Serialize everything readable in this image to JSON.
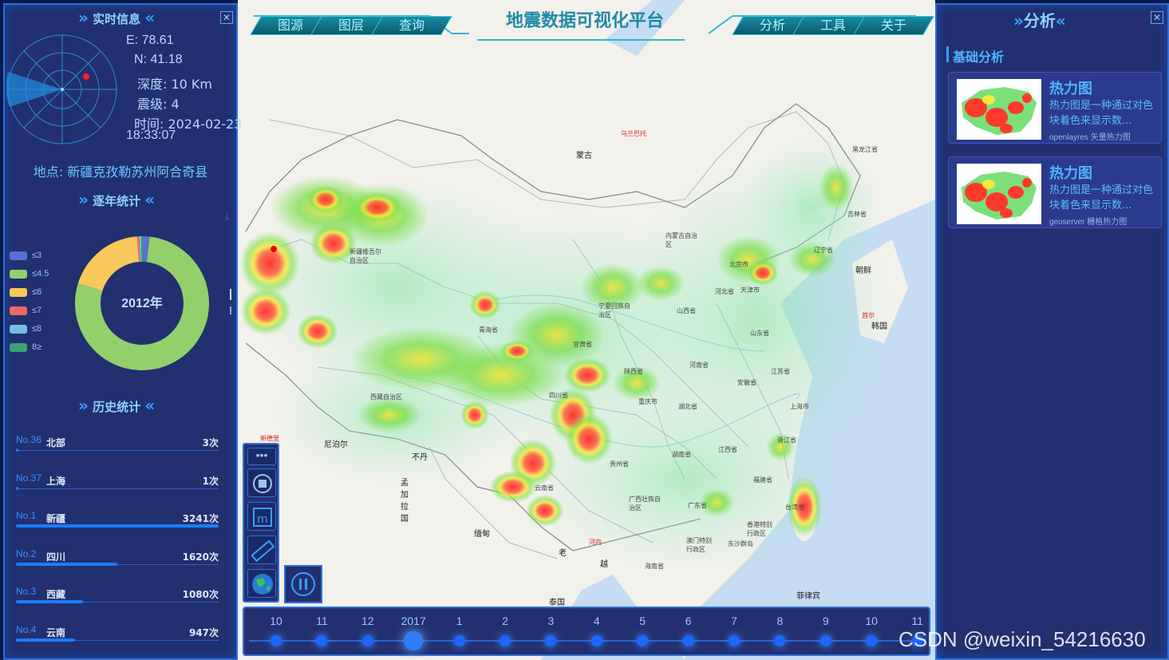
{
  "top": {
    "title": "地震数据可视化平台",
    "left_tabs": [
      "图源",
      "图层",
      "查询"
    ],
    "right_tabs": [
      "分析",
      "工具",
      "关于"
    ]
  },
  "realtime": {
    "title": "实时信息",
    "e": "E: 78.61",
    "n": "N: 41.18",
    "depth": "深度: 10 Km",
    "magnitude": "震级: 4",
    "time_line1": "时间: 2024-02-23",
    "time_line2": "18:33:07",
    "location": "地点: 新疆克孜勒苏州阿合奇县"
  },
  "yearly": {
    "title": "逐年统计",
    "center_label": "2012年",
    "legend": [
      {
        "label": "≤3",
        "color": "#5a6fd6"
      },
      {
        "label": "≤4.5",
        "color": "#93cf6b"
      },
      {
        "label": "≤6",
        "color": "#f8c85a"
      },
      {
        "label": "≤7",
        "color": "#ef6666"
      },
      {
        "label": "≤8",
        "color": "#73c0de"
      },
      {
        "label": "8≥",
        "color": "#3ba272"
      }
    ],
    "donut_values": [
      1.5,
      78,
      19,
      0.5,
      0.5,
      0.5
    ]
  },
  "history": {
    "title": "历史统计",
    "rows": [
      {
        "no": "No.36",
        "name": "北部",
        "count": "3次",
        "fraction": 0.0
      },
      {
        "no": "No.37",
        "name": "上海",
        "count": "1次",
        "fraction": 0.0
      },
      {
        "no": "No.1",
        "name": "新疆",
        "count": "3241次",
        "fraction": 1.0
      },
      {
        "no": "No.2",
        "name": "四川",
        "count": "1620次",
        "fraction": 0.5
      },
      {
        "no": "No.3",
        "name": "西藏",
        "count": "1080次",
        "fraction": 0.33
      },
      {
        "no": "No.4",
        "name": "云南",
        "count": "947次",
        "fraction": 0.29
      }
    ]
  },
  "analysis": {
    "title": "分析",
    "section": "基础分析",
    "cards": [
      {
        "title": "热力图",
        "desc": "热力图是一种通过对色块着色来显示数...",
        "source": "openlayres 矢量热力图"
      },
      {
        "title": "热力图",
        "desc": "热力图是一种通过对色块着色来显示数...",
        "source": "geoserver 栅格热力图"
      }
    ]
  },
  "map_labels": {
    "mongolia": "蒙古",
    "ulaanbaatar": "乌兰巴托",
    "heilongjiang": "黑龙江省",
    "jilin": "吉林省",
    "liaoning": "辽宁省",
    "neimenggu": "内蒙古自治区",
    "beijing": "北京市",
    "tianjin": "天津市",
    "hebei": "河北省",
    "shanxi": "山西省",
    "shandong": "山东省",
    "ningxia": "宁夏回族自治区",
    "gansu": "甘肃省",
    "qinghai": "青海省",
    "shaanxi": "陕西省",
    "henan": "河南省",
    "jiangsu": "江苏省",
    "anhui": "安徽省",
    "shanghai": "上海市",
    "hubei": "湖北省",
    "chongqing": "重庆市",
    "sichuan": "四川省",
    "xizang": "西藏自治区",
    "xinjiang": "新疆维吾尔自治区",
    "zhejiang": "浙江省",
    "hunan": "湖南省",
    "jiangxi": "江西省",
    "fujian": "福建省",
    "taiwan": "台湾省",
    "guizhou": "贵州省",
    "yunnan": "云南省",
    "guangxi": "广西壮族自治区",
    "guangdong": "广东省",
    "hongkong": "香港特别行政区",
    "macau": "澳门特别行政区",
    "hainan": "海南省",
    "korea_n": "朝鲜",
    "korea_s": "韩国",
    "seoul": "首尔",
    "nepal": "尼泊尔",
    "bhutan": "不丹",
    "myanmar": "缅甸",
    "laos": "老",
    "vietnam": "越",
    "thailand": "泰国",
    "philippines": "菲律宾",
    "bangladesh": "孟加拉国",
    "dongsha": "东沙群岛",
    "hanoi": "河内",
    "newdelhi": "新德里"
  },
  "timeline": {
    "labels": [
      "10",
      "11",
      "12",
      "2017",
      "1",
      "2",
      "3",
      "4",
      "5",
      "6",
      "7",
      "8",
      "9",
      "10",
      "11"
    ],
    "active_index": 3
  },
  "watermark": "CSDN @weixin_54216630"
}
